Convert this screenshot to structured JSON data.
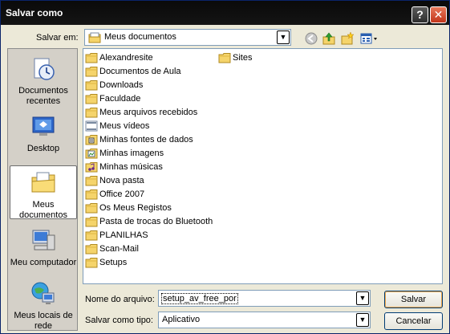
{
  "window": {
    "title": "Salvar como"
  },
  "titlebar": {
    "help": "?",
    "close": "✕"
  },
  "save_in": {
    "label": "Salvar em:",
    "value": "Meus documentos",
    "arrow": "▼"
  },
  "toolbar": {
    "back_icon": "back-icon",
    "up_icon": "up-folder-icon",
    "new_folder_icon": "new-folder-icon",
    "views_icon": "views-menu-icon"
  },
  "places": [
    {
      "label_line1": "Documentos",
      "label_line2": "recentes",
      "icon": "recent-documents-icon"
    },
    {
      "label_line1": "Desktop",
      "label_line2": "",
      "icon": "desktop-icon"
    },
    {
      "label_line1": "Meus",
      "label_line2": "documentos",
      "icon": "my-documents-icon"
    },
    {
      "label_line1": "Meu computador",
      "label_line2": "",
      "icon": "my-computer-icon"
    },
    {
      "label_line1": "Meus locais de",
      "label_line2": "rede",
      "icon": "network-places-icon"
    }
  ],
  "files_col1": [
    {
      "name": "Alexandresite",
      "icon": "folder-icon"
    },
    {
      "name": "Documentos de Aula",
      "icon": "folder-icon"
    },
    {
      "name": "Downloads",
      "icon": "folder-icon"
    },
    {
      "name": "Faculdade",
      "icon": "folder-icon"
    },
    {
      "name": "Meus arquivos recebidos",
      "icon": "folder-icon"
    },
    {
      "name": "Meus vídeos",
      "icon": "video-folder-icon"
    },
    {
      "name": "Minhas fontes de dados",
      "icon": "data-sources-folder-icon"
    },
    {
      "name": "Minhas imagens",
      "icon": "pictures-folder-icon"
    },
    {
      "name": "Minhas músicas",
      "icon": "music-folder-icon"
    },
    {
      "name": "Nova pasta",
      "icon": "folder-icon"
    },
    {
      "name": "Office 2007",
      "icon": "folder-icon"
    },
    {
      "name": "Os Meus Registos",
      "icon": "folder-icon"
    },
    {
      "name": "Pasta de trocas do Bluetooth",
      "icon": "folder-icon"
    },
    {
      "name": "PLANILHAS",
      "icon": "folder-icon"
    },
    {
      "name": "Scan-Mail",
      "icon": "folder-icon"
    },
    {
      "name": "Setups",
      "icon": "folder-icon"
    }
  ],
  "files_col2": [
    {
      "name": "Sites",
      "icon": "folder-icon"
    }
  ],
  "filename": {
    "label": "Nome do arquivo:",
    "value": "setup_av_free_por",
    "arrow": "▼"
  },
  "filetype": {
    "label": "Salvar como tipo:",
    "value": "Aplicativo",
    "arrow": "▼"
  },
  "buttons": {
    "save": "Salvar",
    "cancel": "Cancelar"
  },
  "colors": {
    "titlebar": "#0a0a0a",
    "dialog_bg": "#ece9d8",
    "folder": "#f5d46b",
    "button_border": "#003c74"
  }
}
